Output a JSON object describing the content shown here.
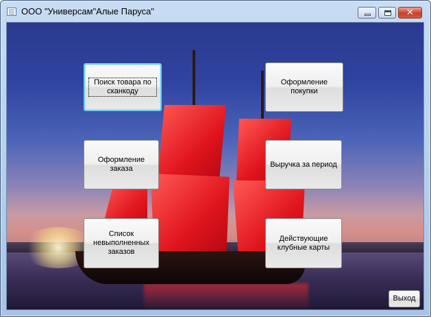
{
  "window": {
    "title": "ООО \"Универсам\"Алые Паруса\"",
    "icon": "form-icon",
    "controls": [
      "minimize-icon",
      "maximize-icon",
      "close-icon"
    ]
  },
  "menu": {
    "buttons": [
      {
        "label": "Поиск товара по сканкоду"
      },
      {
        "label": "Оформление покупки"
      },
      {
        "label": "Оформление заказа"
      },
      {
        "label": "Выручка за период"
      },
      {
        "label": "Список\nневыполненных\nзаказов"
      },
      {
        "label": "Действующие\nклубные карты"
      }
    ],
    "exit_label": "Выход"
  },
  "colors": {
    "focus_border": "#6ccdf5",
    "close_button": "#c9402a",
    "sail_red": "#e0141c"
  }
}
